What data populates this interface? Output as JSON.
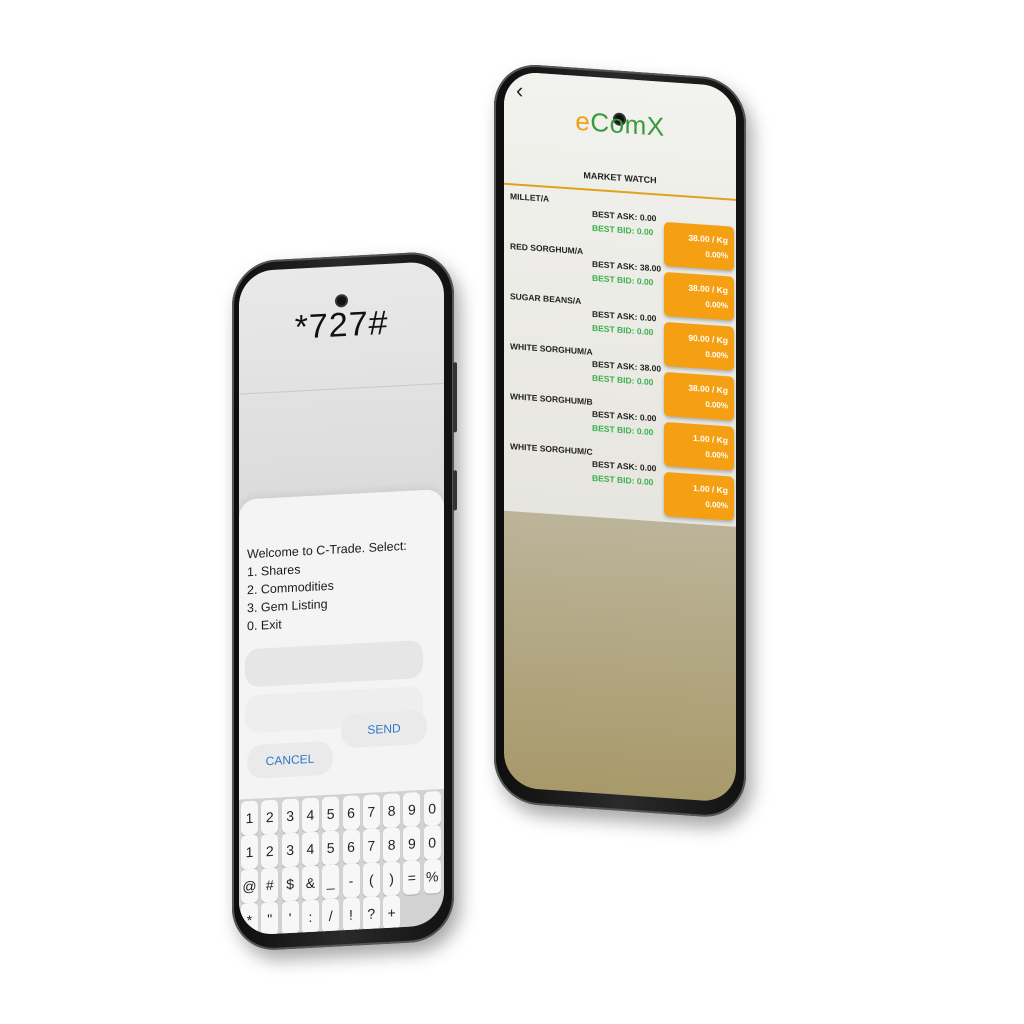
{
  "ussd": {
    "code": "*727#",
    "lines": [
      "Welcome to C-Trade. Select:",
      "1. Shares",
      "2. Commodities",
      "3. Gem Listing",
      "0. Exit"
    ],
    "cancel_label": "CANCEL",
    "send_label": "SEND",
    "keyboard": {
      "row1": [
        "1",
        "2",
        "3",
        "4",
        "5",
        "6",
        "7",
        "8",
        "9",
        "0"
      ],
      "row2": [
        "1",
        "2",
        "3",
        "4",
        "5",
        "6",
        "7",
        "8",
        "9",
        "0"
      ],
      "row3": [
        "@",
        "#",
        "$",
        "&",
        "_",
        "-",
        "(",
        ")",
        "=",
        "%"
      ],
      "row4": [
        "*",
        "\"",
        "'",
        ":",
        "/",
        "!",
        "?",
        "+"
      ]
    }
  },
  "ecomx": {
    "back_icon": "chevron-left-icon",
    "logo_e": "e",
    "logo_rest": "ComX",
    "title": "MARKET WATCH",
    "rows": [
      {
        "name": "MILLET/A",
        "ask": "BEST ASK: 0.00",
        "bid": "BEST BID: 0.00",
        "price": "38.00 / Kg",
        "change": "0.00%"
      },
      {
        "name": "RED SORGHUM/A",
        "ask": "BEST ASK: 38.00",
        "bid": "BEST BID: 0.00",
        "price": "38.00 / Kg",
        "change": "0.00%"
      },
      {
        "name": "SUGAR BEANS/A",
        "ask": "BEST ASK: 0.00",
        "bid": "BEST BID: 0.00",
        "price": "90.00 / Kg",
        "change": "0.00%"
      },
      {
        "name": "WHITE SORGHUM/A",
        "ask": "BEST ASK: 38.00",
        "bid": "BEST BID: 0.00",
        "price": "38.00 / Kg",
        "change": "0.00%"
      },
      {
        "name": "WHITE SORGHUM/B",
        "ask": "BEST ASK: 0.00",
        "bid": "BEST BID: 0.00",
        "price": "1.00 / Kg",
        "change": "0.00%"
      },
      {
        "name": "WHITE SORGHUM/C",
        "ask": "BEST ASK: 0.00",
        "bid": "BEST BID: 0.00",
        "price": "1.00 / Kg",
        "change": "0.00%"
      }
    ],
    "colors": {
      "accent": "#f5a012",
      "bid_green": "#3cb04a",
      "logo_green": "#3a9a3a"
    }
  }
}
